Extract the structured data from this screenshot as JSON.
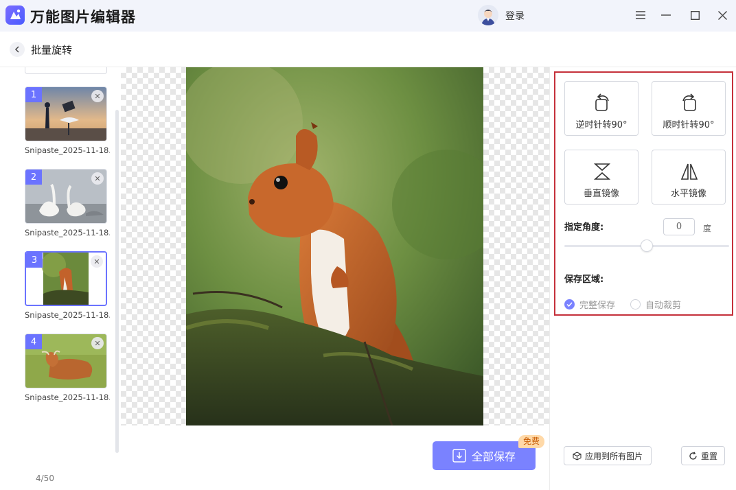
{
  "app": {
    "title": "万能图片编辑器",
    "login_label": "登录"
  },
  "header": {
    "page_title": "批量旋转"
  },
  "thumbnails": [
    {
      "index": "1",
      "name": "Snipaste_2025-11-18..."
    },
    {
      "index": "2",
      "name": "Snipaste_2025-11-18..."
    },
    {
      "index": "3",
      "name": "Snipaste_2025-11-18..."
    },
    {
      "index": "4",
      "name": "Snipaste_2025-11-18..."
    }
  ],
  "page_count": "4/50",
  "actions": {
    "save_all": "全部保存",
    "free_badge": "免费"
  },
  "tools": {
    "rotate_ccw": "逆时针转90°",
    "rotate_cw": "顺时针转90°",
    "flip_vertical": "垂直镜像",
    "flip_horizontal": "水平镜像",
    "angle_label": "指定角度:",
    "angle_value": "0",
    "angle_unit": "度",
    "save_area_label": "保存区域:",
    "save_full": "完整保存",
    "auto_crop": "自动裁剪"
  },
  "footer": {
    "apply_all": "应用到所有图片",
    "reset": "重置"
  },
  "colors": {
    "accent": "#7a82ff",
    "highlight_border": "#c5303a",
    "badge_text": "#c85a00"
  }
}
